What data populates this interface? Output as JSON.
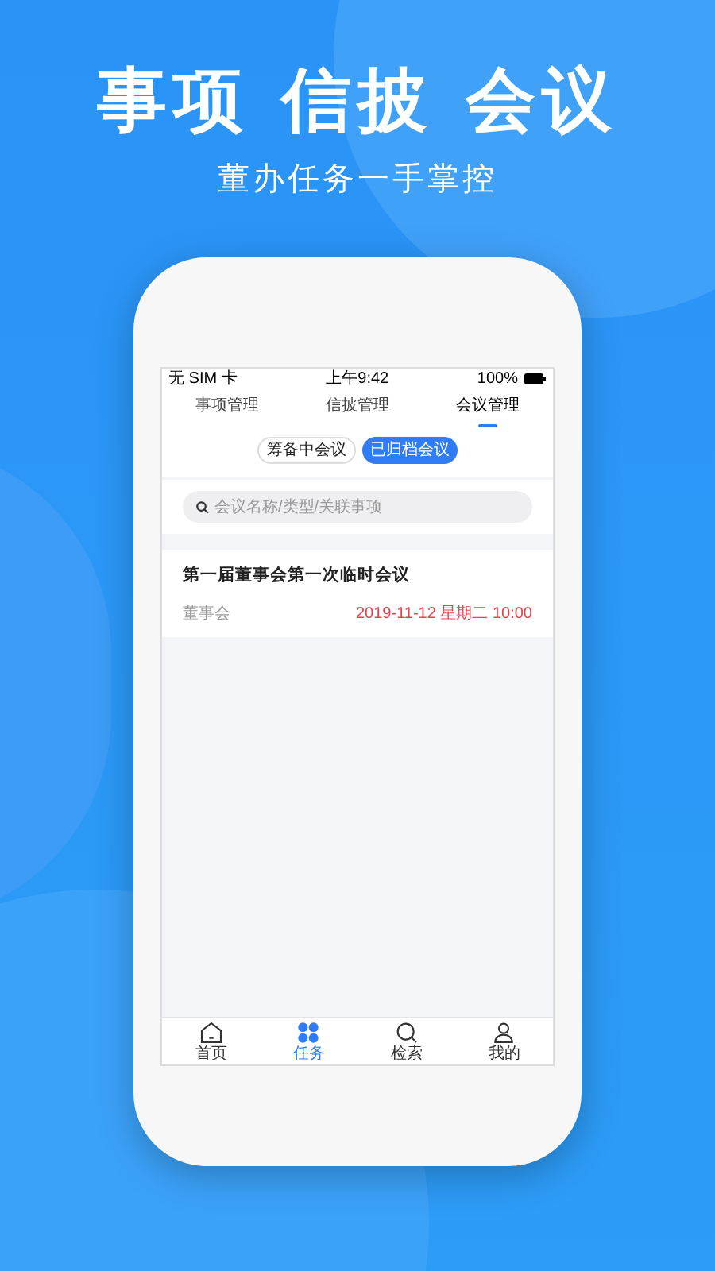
{
  "headline_words": [
    "事项",
    "信披",
    "会议"
  ],
  "subtitle": "董办任务一手掌控",
  "status_bar": {
    "carrier": "无 SIM 卡",
    "time": "上午9:42",
    "battery": "100%"
  },
  "tabs": [
    {
      "label": "事项管理",
      "selected": false
    },
    {
      "label": "信披管理",
      "selected": false
    },
    {
      "label": "会议管理",
      "selected": true
    }
  ],
  "segments": [
    {
      "label": "筹备中会议",
      "selected": false
    },
    {
      "label": "已归档会议",
      "selected": true
    }
  ],
  "search": {
    "placeholder": "会议名称/类型/关联事项"
  },
  "meetings": [
    {
      "title": "第一届董事会第一次临时会议",
      "type": "董事会",
      "time": "2019-11-12 星期二 10:00"
    }
  ],
  "nav": [
    {
      "label": "首页",
      "selected": false
    },
    {
      "label": "任务",
      "selected": true
    },
    {
      "label": "检索",
      "selected": false
    },
    {
      "label": "我的",
      "selected": false
    }
  ]
}
